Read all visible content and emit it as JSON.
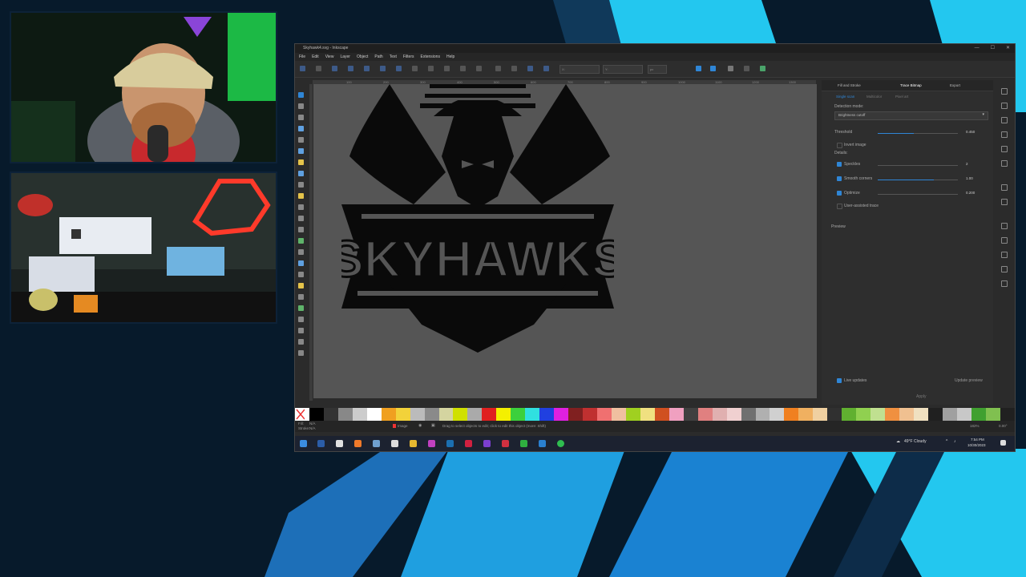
{
  "window": {
    "title": "Skyhawk4.svg - Inkscape",
    "controls": {
      "minimize": "—",
      "maximize": "☐",
      "close": "✕"
    }
  },
  "menu": [
    "File",
    "Edit",
    "View",
    "Layer",
    "Object",
    "Path",
    "Text",
    "Filters",
    "Extensions",
    "Help"
  ],
  "toolbar": {
    "x_label": "X:",
    "y_label": "Y:",
    "unit": "px"
  },
  "ruler": [
    "100",
    "200",
    "300",
    "400",
    "500",
    "600",
    "700",
    "800",
    "900",
    "1000",
    "1100",
    "1200",
    "1300",
    "1400"
  ],
  "logo": {
    "text": "SKYHAWKS",
    "fill": "#0a0a0a"
  },
  "panel": {
    "tabs": [
      "Fill and Stroke",
      "Trace Bitmap",
      "Export"
    ],
    "subtabs": [
      "Single scan",
      "Multicolor",
      "Pixel art"
    ],
    "detection_label": "Detection mode:",
    "mode": "Brightness cutoff",
    "threshold_label": "Threshold",
    "threshold_value": "0.450",
    "invert_label": "Invert image",
    "details_label": "Details:",
    "speckles_label": "Speckles",
    "speckles_value": "2",
    "smooth_label": "Smooth corners",
    "smooth_value": "1.00",
    "optimize_label": "Optimize",
    "optimize_value": "0.200",
    "user_assisted_label": "User-assisted trace",
    "preview_label": "Preview",
    "live_updates_label": "Live updates",
    "update_preview_label": "Update preview",
    "apply_label": "Apply"
  },
  "status": {
    "fill_label": "Fill:",
    "stroke_label": "Stroke:",
    "fill_value": "N/A",
    "stroke_value": "N/A",
    "layer": "Image",
    "message": "Drag to select objects to edit; click to edit this object (more: Shift)",
    "zoom": "182%",
    "rotation": "0.00°"
  },
  "taskbar": {
    "weather": "49°F Cloudy",
    "time": "7:54 PM",
    "date": "10/30/2023"
  },
  "colors": {
    "accent": "#2f86d6",
    "bg_cyan": "#22c6f0",
    "bg_blue": "#1a7fd0"
  }
}
